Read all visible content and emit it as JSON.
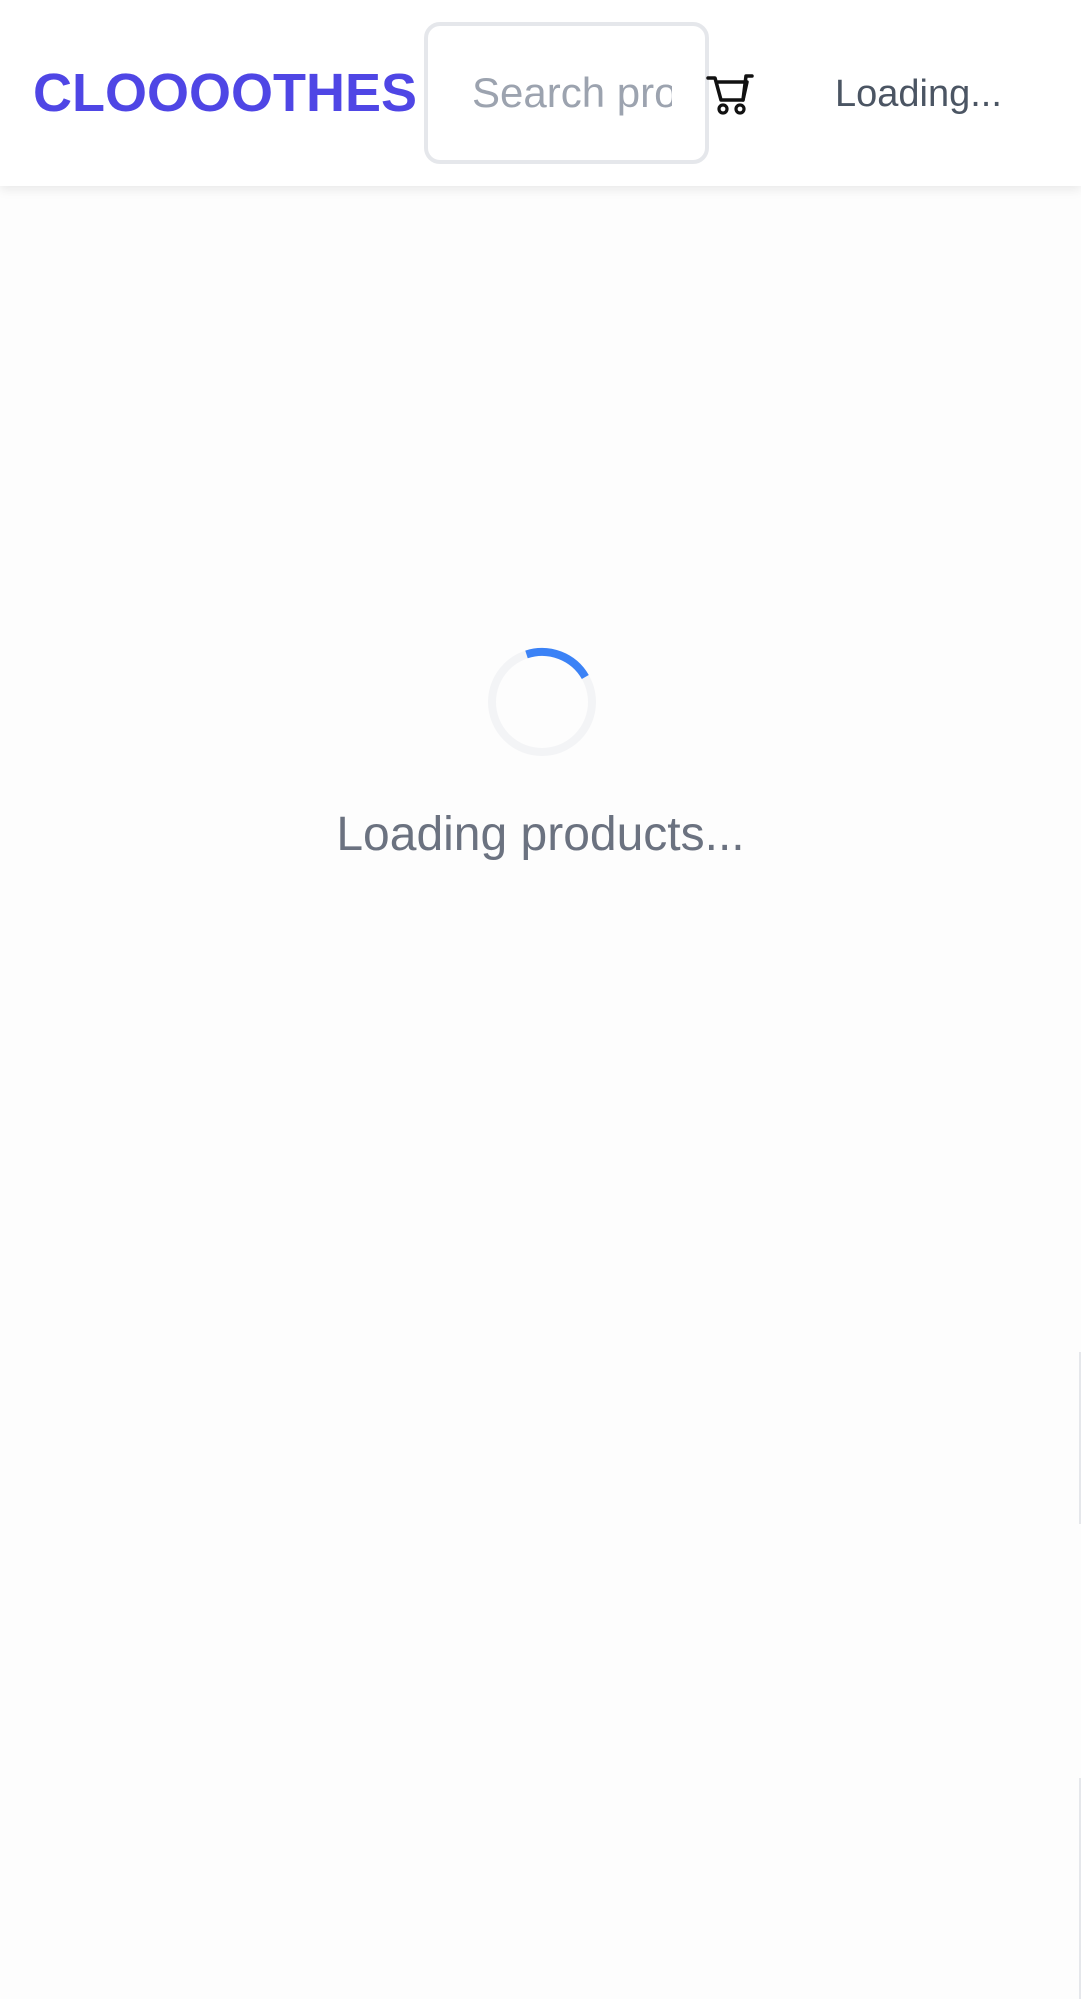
{
  "header": {
    "logo": "CLOOOOTHES",
    "search": {
      "placeholder": "Search products...",
      "value": ""
    },
    "cart": {
      "icon": "shopping-cart-icon"
    },
    "user_status": "Loading..."
  },
  "main": {
    "spinner_icon": "spinner-icon",
    "loading_message": "Loading products..."
  },
  "colors": {
    "brand": "#4f46e5",
    "spinner_accent": "#3b82f6",
    "spinner_track": "#f3f4f6",
    "muted_text": "#6b7280",
    "border": "#e5e7eb"
  }
}
